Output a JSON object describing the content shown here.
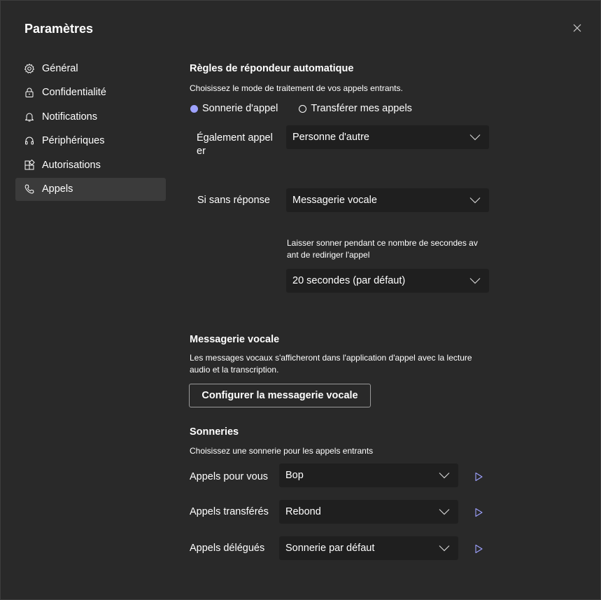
{
  "window": {
    "title": "Paramètres"
  },
  "sidebar": {
    "items": [
      {
        "label": "Général",
        "icon": "gear-icon"
      },
      {
        "label": "Confidentialité",
        "icon": "lock-icon"
      },
      {
        "label": "Notifications",
        "icon": "bell-icon"
      },
      {
        "label": "Périphériques",
        "icon": "headset-icon"
      },
      {
        "label": "Autorisations",
        "icon": "apps-icon"
      },
      {
        "label": "Appels",
        "icon": "phone-icon",
        "active": true
      }
    ]
  },
  "answer_rules": {
    "title": "Règles de répondeur automatique",
    "description": "Choisissez le mode de traitement de vos appels entrants.",
    "radio_ring": "Sonnerie d'appel",
    "radio_forward": "Transférer mes appels",
    "also_ring_label_line1": "Également appel",
    "also_ring_label_line2": "er",
    "also_ring_value": "Personne d'autre",
    "no_answer_label": "Si sans réponse",
    "no_answer_value": "Messagerie vocale",
    "ring_time_desc_line1": "Laisser sonner pendant ce nombre de secondes av",
    "ring_time_desc_line2": "ant de rediriger l'appel",
    "ring_time_value": "20 secondes (par défaut)"
  },
  "voicemail": {
    "title": "Messagerie vocale",
    "description_line1": "Les messages vocaux s'afficheront dans l'application d'appel avec la lecture",
    "description_line2": "audio et la transcription.",
    "configure_button": "Configurer la messagerie vocale"
  },
  "ringtones": {
    "title": "Sonneries",
    "description": "Choisissez une sonnerie pour les appels entrants",
    "rows": [
      {
        "label": "Appels pour vous",
        "value": "Bop"
      },
      {
        "label": "Appels transférés",
        "value": "Rebond"
      },
      {
        "label": "Appels délégués",
        "value": "Sonnerie par défaut"
      }
    ]
  },
  "colors": {
    "background": "#292929",
    "dropdown": "#1f1f1f",
    "accent": "#9ea2ff",
    "active_nav": "#3b3b3b"
  }
}
